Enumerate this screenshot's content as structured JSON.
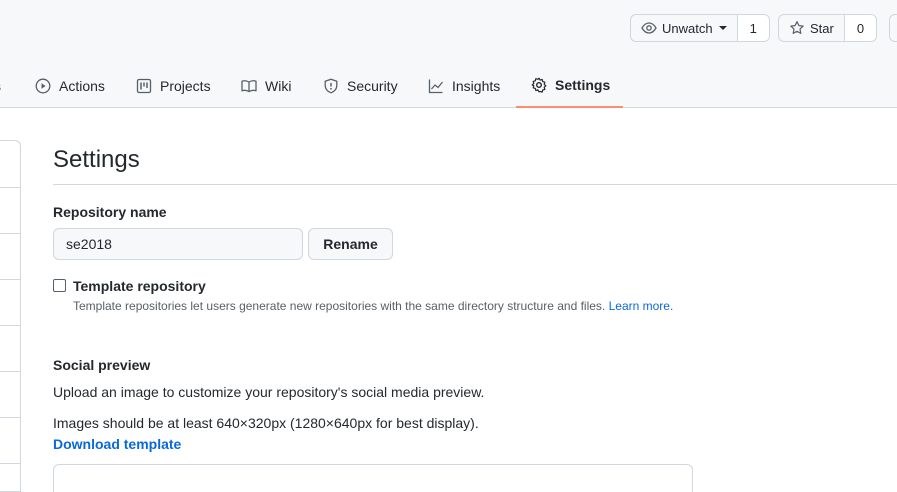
{
  "header": {
    "watch": {
      "label": "Unwatch",
      "count": "1"
    },
    "star": {
      "label": "Star",
      "count": "0"
    }
  },
  "tabs": [
    {
      "label": "Actions",
      "icon": "play-icon"
    },
    {
      "label": "Projects",
      "icon": "project-icon"
    },
    {
      "label": "Wiki",
      "icon": "book-icon"
    },
    {
      "label": "Security",
      "icon": "shield-icon"
    },
    {
      "label": "Insights",
      "icon": "graph-icon"
    },
    {
      "label": "Settings",
      "icon": "gear-icon",
      "selected": true
    }
  ],
  "main": {
    "title": "Settings",
    "repo_name_label": "Repository name",
    "repo_name_value": "se2018",
    "rename_label": "Rename",
    "template_label": "Template repository",
    "template_note": "Template repositories let users generate new repositories with the same directory structure and files.",
    "learn_more": "Learn more.",
    "social_preview_title": "Social preview",
    "social_preview_desc": "Upload an image to customize your repository's social media preview.",
    "image_size_note": "Images should be at least 640×320px (1280×640px for best display).",
    "download_template": "Download template"
  },
  "colors": {
    "accent_link": "#0969da",
    "tab_underline": "#fd8c73",
    "border": "#d0d7de",
    "muted_text": "#57606a"
  }
}
